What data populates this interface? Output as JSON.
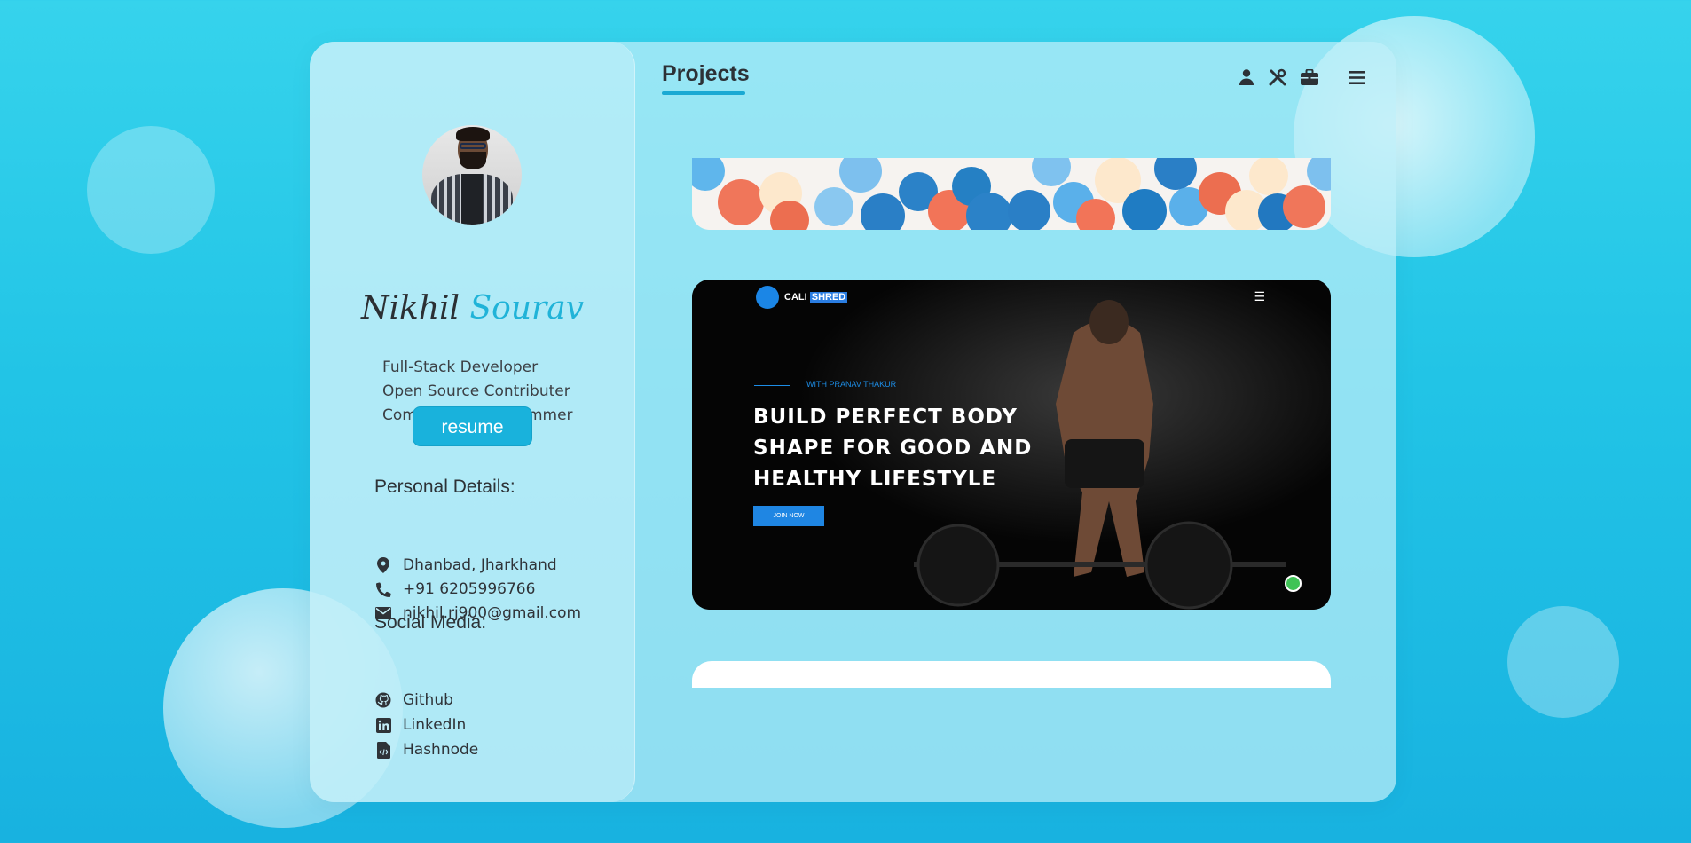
{
  "profile": {
    "first_name": "Nikhil",
    "last_name": "Sourav",
    "roles": [
      "Full-Stack Developer",
      "Open Source Contributer",
      "Competitive Programmer"
    ],
    "resume_label": "resume"
  },
  "personal_details": {
    "title": "Personal Details:",
    "location": "Dhanbad, Jharkhand",
    "phone": "+91 6205996766",
    "email": "nikhil.rj900@gmail.com"
  },
  "social_media": {
    "title": "Social Media:",
    "links": [
      "Github",
      "LinkedIn",
      "Hashnode"
    ]
  },
  "header": {
    "title": "Projects",
    "nav_icons": [
      "user-icon",
      "tools-icon",
      "briefcase-icon",
      "menu-icon"
    ]
  },
  "projects": {
    "calishred": {
      "logo_text": "CALI",
      "logo_highlight": "SHRED",
      "tag": "WITH PRANAV THAKUR",
      "headline_1": "BUILD PERFECT BODY",
      "headline_2": "SHAPE FOR GOOD AND",
      "headline_3": "HEALTHY LIFESTYLE",
      "cta": "JOIN NOW"
    }
  },
  "colors": {
    "accent": "#1ab2dc",
    "background": "#2bcbe9",
    "text": "#2d3236"
  }
}
